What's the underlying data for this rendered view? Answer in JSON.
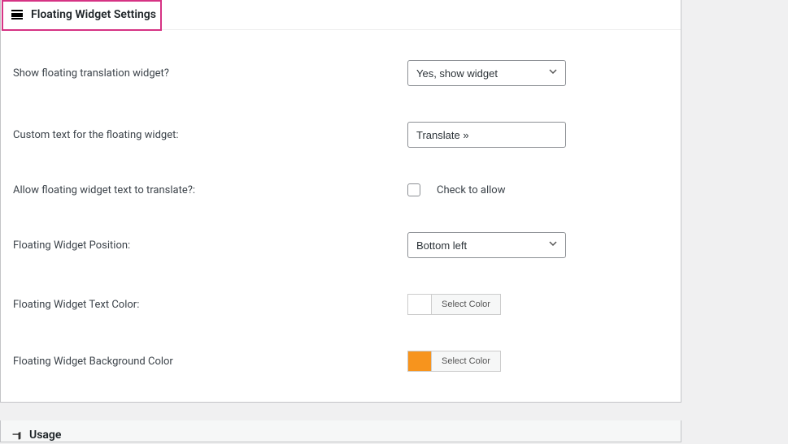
{
  "panel": {
    "title": "Floating Widget Settings"
  },
  "settings": {
    "showWidget": {
      "label": "Show floating translation widget?",
      "value": "Yes, show widget"
    },
    "customText": {
      "label": "Custom text for the floating widget:",
      "value": "Translate »"
    },
    "allowTranslate": {
      "label": "Allow floating widget text to translate?:",
      "checkLabel": "Check to allow"
    },
    "position": {
      "label": "Floating Widget Position:",
      "value": "Bottom left"
    },
    "textColor": {
      "label": "Floating Widget Text Color:",
      "button": "Select Color"
    },
    "bgColor": {
      "label": "Floating Widget Background Color",
      "button": "Select Color"
    }
  },
  "usage": {
    "title": "Usage"
  }
}
